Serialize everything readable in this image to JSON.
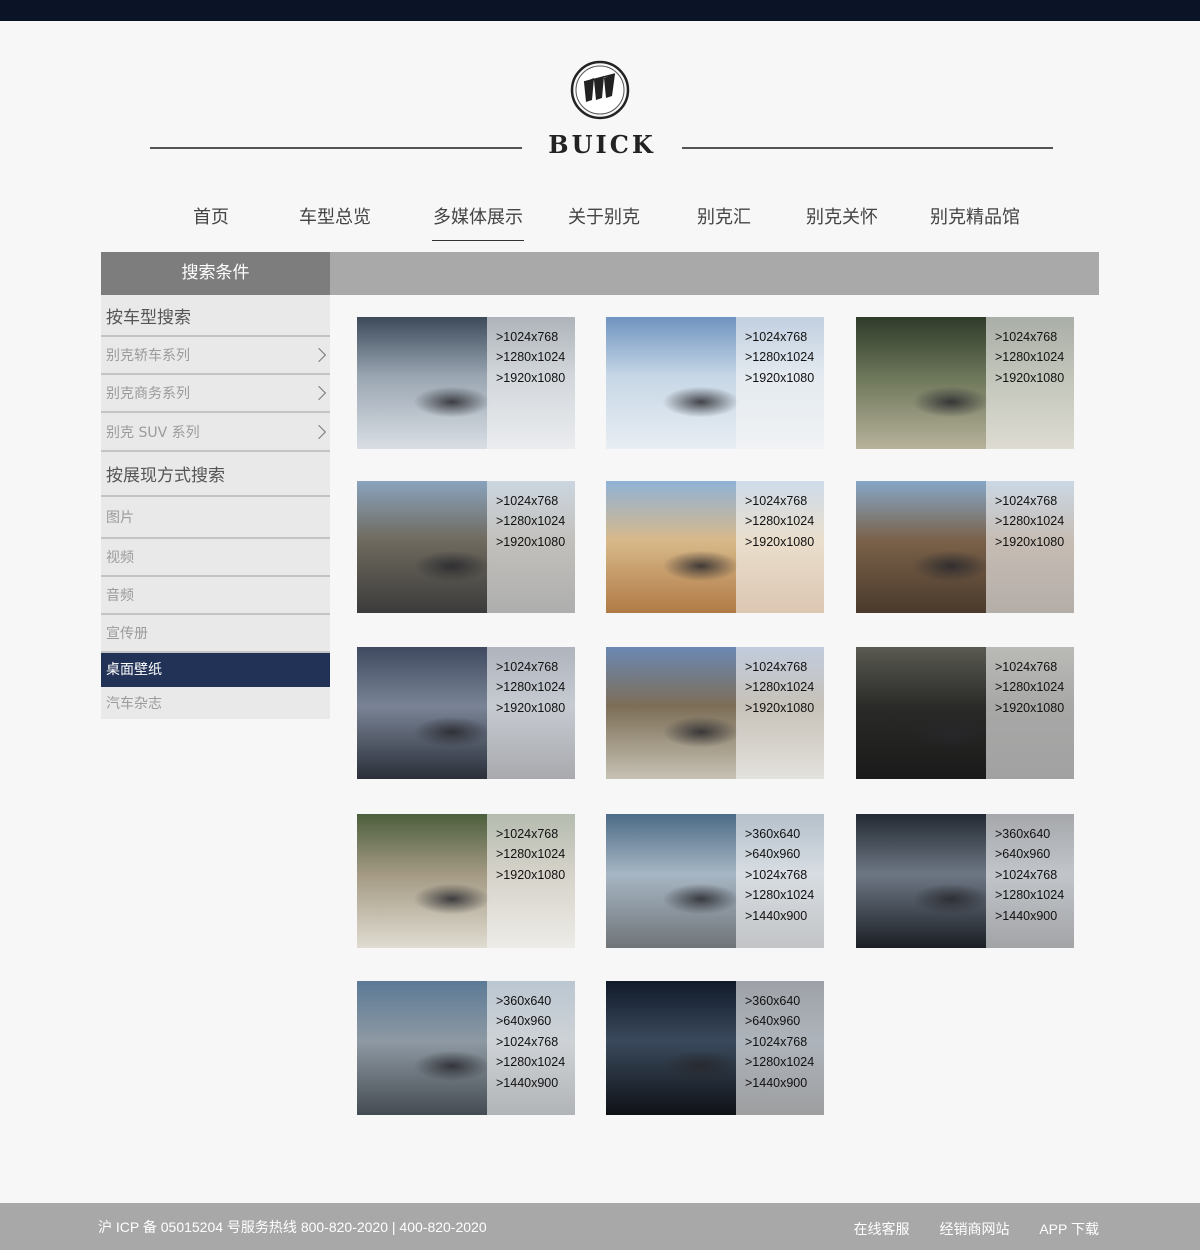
{
  "brand": {
    "name": "BUICK"
  },
  "nav": [
    "首页",
    "车型总览",
    "多媒体展示",
    "关于别克",
    "别克汇",
    "别克关怀",
    "别克精品馆"
  ],
  "sidebar": {
    "header": "搜索条件",
    "group_model": "按车型搜索",
    "models": [
      "别克轿车系列",
      "别克商务系列",
      "别克 SUV 系列"
    ],
    "group_format": "按展现方式搜索",
    "formats": [
      "图片",
      "视频",
      "音频",
      "宣传册",
      "桌面壁纸",
      "汽车杂志"
    ],
    "active_format": "桌面壁纸"
  },
  "wallpapers": [
    {
      "scene": "snowy-road",
      "sizes": [
        ">1024x768",
        ">1280x1024",
        ">1920x1080"
      ]
    },
    {
      "scene": "snow-mountain",
      "sizes": [
        ">1024x768",
        ">1280x1024",
        ">1920x1080"
      ]
    },
    {
      "scene": "curved-road",
      "sizes": [
        ">1024x768",
        ">1280x1024",
        ">1920x1080"
      ]
    },
    {
      "scene": "mountain-road",
      "sizes": [
        ">1024x768",
        ">1280x1024",
        ">1920x1080"
      ]
    },
    {
      "scene": "desert",
      "sizes": [
        ">1024x768",
        ">1280x1024",
        ">1920x1080"
      ]
    },
    {
      "scene": "mud-splash",
      "sizes": [
        ">1024x768",
        ">1280x1024",
        ">1920x1080"
      ]
    },
    {
      "scene": "bridge",
      "sizes": [
        ">1024x768",
        ">1280x1024",
        ">1920x1080"
      ]
    },
    {
      "scene": "rocky-hill",
      "sizes": [
        ">1024x768",
        ">1280x1024",
        ">1920x1080"
      ]
    },
    {
      "scene": "interior",
      "sizes": [
        ">1024x768",
        ">1280x1024",
        ">1920x1080"
      ]
    },
    {
      "scene": "dirt-trail",
      "sizes": [
        ">1024x768",
        ">1280x1024",
        ">1920x1080"
      ]
    },
    {
      "scene": "airport",
      "sizes": [
        ">360x640",
        ">640x960",
        ">1024x768",
        ">1280x1024",
        ">1440x900"
      ]
    },
    {
      "scene": "tunnel",
      "sizes": [
        ">360x640",
        ">640x960",
        ">1024x768",
        ">1280x1024",
        ">1440x900"
      ]
    },
    {
      "scene": "construction",
      "sizes": [
        ">360x640",
        ">640x960",
        ">1024x768",
        ">1280x1024",
        ">1440x900"
      ]
    },
    {
      "scene": "night",
      "sizes": [
        ">360x640",
        ">640x960",
        ">1024x768",
        ">1280x1024",
        ">1440x900"
      ]
    }
  ],
  "footer": {
    "copyright": "沪 ICP 备 05015204 号服务热线 800-820-2020 | 400-820-2020",
    "links": [
      "在线客服",
      "经销商网站",
      "APP 下载"
    ]
  },
  "colors": {
    "topbar": "#0b1427",
    "active_nav_bg": "#223256",
    "sidebar_header": "#7d7d7d",
    "footer": "#a8a8a8"
  }
}
